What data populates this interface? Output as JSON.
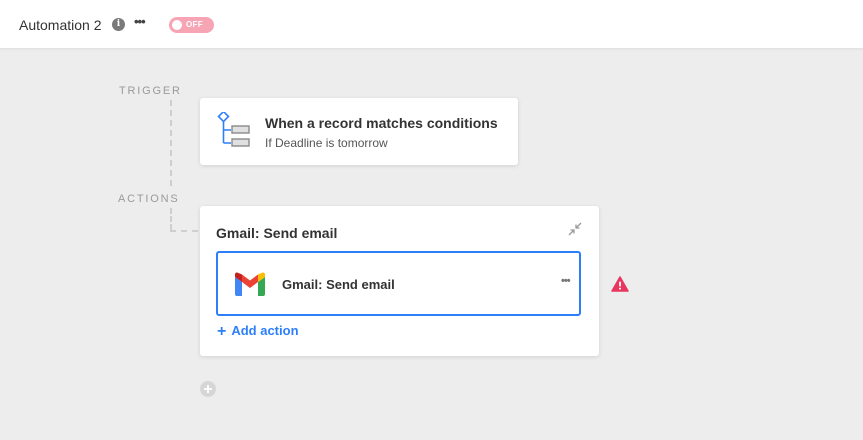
{
  "header": {
    "title": "Automation 2",
    "info_icon": "info-icon",
    "more_icon": "more-horizontal-icon",
    "toggle": {
      "label": "OFF",
      "state": "off",
      "color": "#f7a5b5"
    }
  },
  "flow": {
    "trigger_label": "TRIGGER",
    "actions_label": "ACTIONS"
  },
  "trigger": {
    "title": "When a record matches conditions",
    "subtitle": "If Deadline is tomorrow",
    "icon": "conditions-tree-icon"
  },
  "action": {
    "title": "Gmail: Send email",
    "collapse_icon": "collapse-icon",
    "step": {
      "label": "Gmail: Send email",
      "icon": "gmail-icon",
      "more_icon": "more-horizontal-icon"
    },
    "add_label": "Add action",
    "warning_icon": "warning-icon",
    "warning_color": "#e8375e"
  },
  "add_step_icon": "plus-circle-icon",
  "colors": {
    "accent": "#2d7ff9",
    "background": "#ededed"
  }
}
